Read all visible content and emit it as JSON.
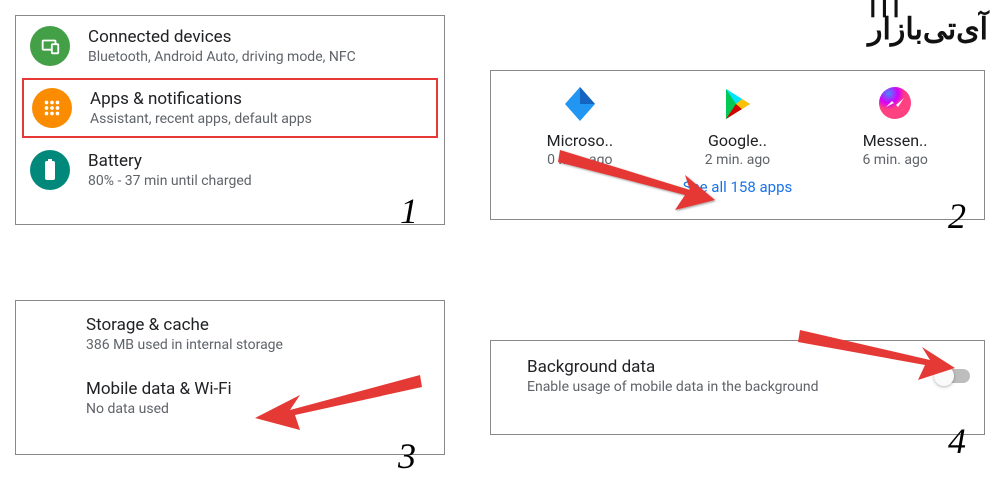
{
  "logo_text": "آی‌تی‌بازار",
  "panel1": {
    "items": [
      {
        "title": "Connected devices",
        "subtitle": "Bluetooth, Android Auto, driving mode, NFC"
      },
      {
        "title": "Apps & notifications",
        "subtitle": "Assistant, recent apps, default apps"
      },
      {
        "title": "Battery",
        "subtitle": "80% - 37 min until charged"
      }
    ]
  },
  "panel2": {
    "apps": [
      {
        "name": "Microso..",
        "time": "0 min. ago"
      },
      {
        "name": "Google..",
        "time": "2 min. ago"
      },
      {
        "name": "Messen..",
        "time": "6 min. ago"
      }
    ],
    "see_all": "See all 158 apps"
  },
  "panel3": {
    "items": [
      {
        "title": "Storage & cache",
        "subtitle": "386 MB used in internal storage"
      },
      {
        "title": "Mobile data & Wi-Fi",
        "subtitle": "No data used"
      }
    ]
  },
  "panel4": {
    "title": "Background data",
    "subtitle": "Enable usage of mobile data in the background"
  },
  "steps": {
    "s1": "1",
    "s2": "2",
    "s3": "3",
    "s4": "4"
  }
}
